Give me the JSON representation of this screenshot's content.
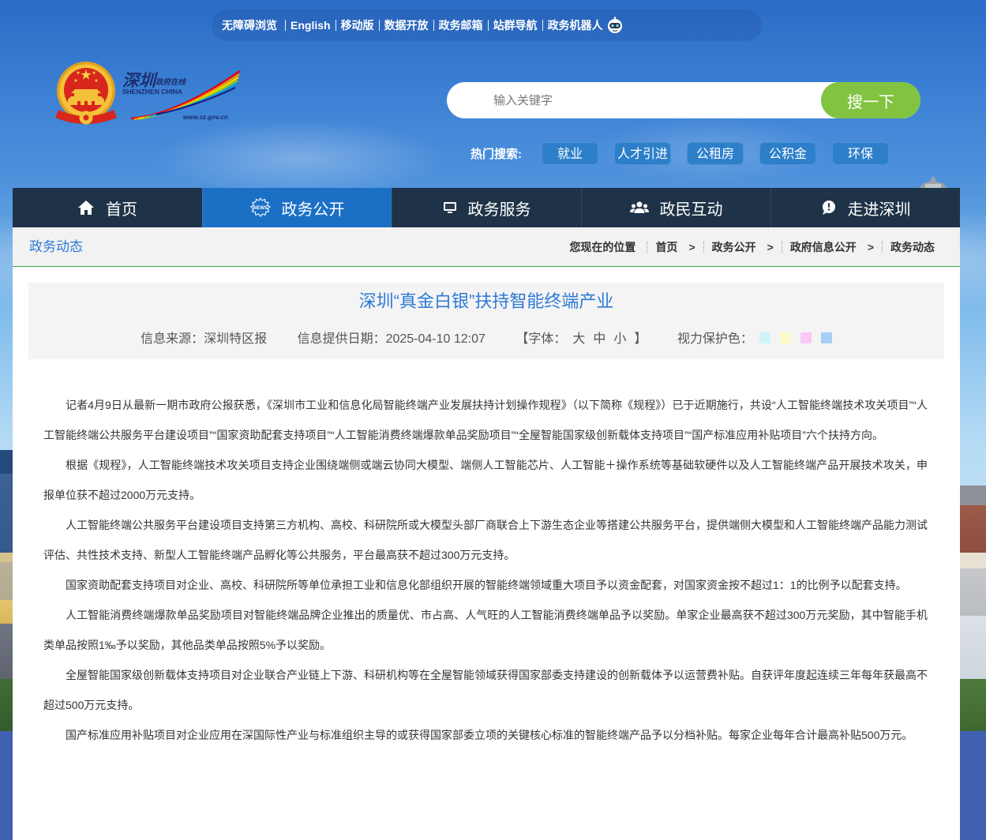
{
  "top_links": {
    "items": [
      "无障碍浏览",
      "English",
      "移动版",
      "数据开放",
      "政务邮箱",
      "站群导航",
      "政务机器人"
    ],
    "robot_icon": "robot-icon"
  },
  "logo": {
    "emblem_icon": "national-emblem-icon",
    "city_name": "深圳",
    "tagline": "政府在线",
    "english": "SHENZHEN CHINA",
    "url": "www.sz.gov.cn"
  },
  "search": {
    "placeholder": "输入关键字",
    "value": "",
    "button": "搜一下"
  },
  "hot_search": {
    "label": "热门搜索:",
    "items": [
      "就业",
      "人才引进",
      "公租房",
      "公积金",
      "环保"
    ]
  },
  "nav": {
    "items": [
      {
        "label": "首页",
        "icon": "home-icon",
        "active": false
      },
      {
        "label": "政务公开",
        "icon": "news-icon",
        "icon_text": "NEWS",
        "active": true
      },
      {
        "label": "政务服务",
        "icon": "monitor-icon",
        "active": false
      },
      {
        "label": "政民互动",
        "icon": "users-icon",
        "active": false
      },
      {
        "label": "走进深圳",
        "icon": "chat-icon",
        "active": false
      }
    ]
  },
  "breadcrumb": {
    "section_title": "政务动态",
    "location_label": "您现在的位置",
    "items": [
      "首页",
      "政务公开",
      "政府信息公开",
      "政务动态"
    ],
    "separator": ">"
  },
  "article": {
    "title": "深圳“真金白银”扶持智能终端产业",
    "source_label": "信息来源：",
    "source": "深圳特区报",
    "date_label": "信息提供日期：",
    "date": "2025-04-10 12:07",
    "font_label": "【字体：",
    "font_sizes": [
      "大",
      "中",
      "小"
    ],
    "font_close": "】",
    "eye_care_label": "视力保护色：",
    "eye_care_colors": [
      "#cdf5f8",
      "#fafac8",
      "#f9c9f6",
      "#a7cff5"
    ],
    "paragraphs": [
      "记者4月9日从最新一期市政府公报获悉，《深圳市工业和信息化局智能终端产业发展扶持计划操作规程》（以下简称《规程》）已于近期施行，共设“人工智能终端技术攻关项目”“人工智能终端公共服务平台建设项目”“国家资助配套支持项目”“人工智能消费终端爆款单品奖励项目”“全屋智能国家级创新载体支持项目”“国产标准应用补贴项目”六个扶持方向。",
      "根据《规程》，人工智能终端技术攻关项目支持企业围绕端侧或端云协同大模型、端侧人工智能芯片、人工智能＋操作系统等基础软硬件以及人工智能终端产品开展技术攻关，申报单位获不超过2000万元支持。",
      "人工智能终端公共服务平台建设项目支持第三方机构、高校、科研院所或大模型头部厂商联合上下游生态企业等搭建公共服务平台，提供端侧大模型和人工智能终端产品能力测试评估、共性技术支持、新型人工智能终端产品孵化等公共服务，平台最高获不超过300万元支持。",
      "国家资助配套支持项目对企业、高校、科研院所等单位承担工业和信息化部组织开展的智能终端领域重大项目予以资金配套，对国家资金按不超过1：1的比例予以配套支持。",
      "人工智能消费终端爆款单品奖励项目对智能终端品牌企业推出的质量优、市占高、人气旺的人工智能消费终端单品予以奖励。单家企业最高获不超过300万元奖励，其中智能手机类单品按照1‰予以奖励，其他品类单品按照5%予以奖励。",
      "全屋智能国家级创新载体支持项目对企业联合产业链上下游、科研机构等在全屋智能领域获得国家部委支持建设的创新载体予以运营费补贴。自获评年度起连续三年每年获最高不超过500万元支持。",
      "国产标准应用补贴项目对企业应用在深国际性产业与标准组织主导的或获得国家部委立项的关键核心标准的智能终端产品予以分档补贴。每家企业每年合计最高补贴500万元。"
    ]
  },
  "colors": {
    "nav_bg": "#1f3348",
    "nav_active": "#1b70c6",
    "accent_blue": "#2d7ad4",
    "search_button": "#82c341",
    "hot_pill": "#2d7fca",
    "breadcrumb_border": "#3fa64c",
    "body_text": "#333333"
  }
}
